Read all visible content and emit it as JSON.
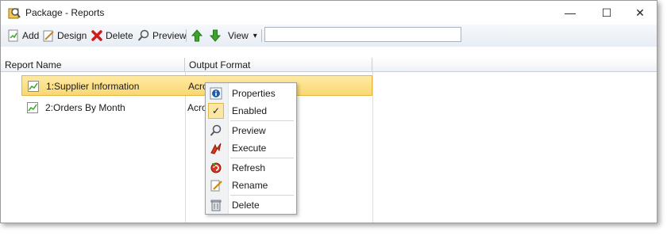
{
  "window": {
    "title": "Package - Reports",
    "minimize": "—",
    "maximize": "☐",
    "close": "✕"
  },
  "toolbar": {
    "add_label": "Add",
    "design_label": "Design",
    "delete_label": "Delete",
    "preview_label": "Preview",
    "view_label": "View",
    "view_dropdown": "▾",
    "search_value": ""
  },
  "columns": {
    "report_name": "Report Name",
    "output_format": "Output Format"
  },
  "rows": [
    {
      "name": "1:Supplier Information",
      "format": "Acrobat Format (*.pdf)"
    },
    {
      "name": "2:Orders By Month",
      "format": "Acrobat Format (*.pdf)"
    }
  ],
  "context_menu": {
    "properties": "Properties",
    "enabled": "Enabled",
    "enabled_check": "✓",
    "preview": "Preview",
    "execute": "Execute",
    "refresh": "Refresh",
    "rename": "Rename",
    "delete": "Delete"
  },
  "colors": {
    "selection": "#f9d774",
    "toolbar": "#e8edf4",
    "accent_green": "#3aa52a"
  }
}
